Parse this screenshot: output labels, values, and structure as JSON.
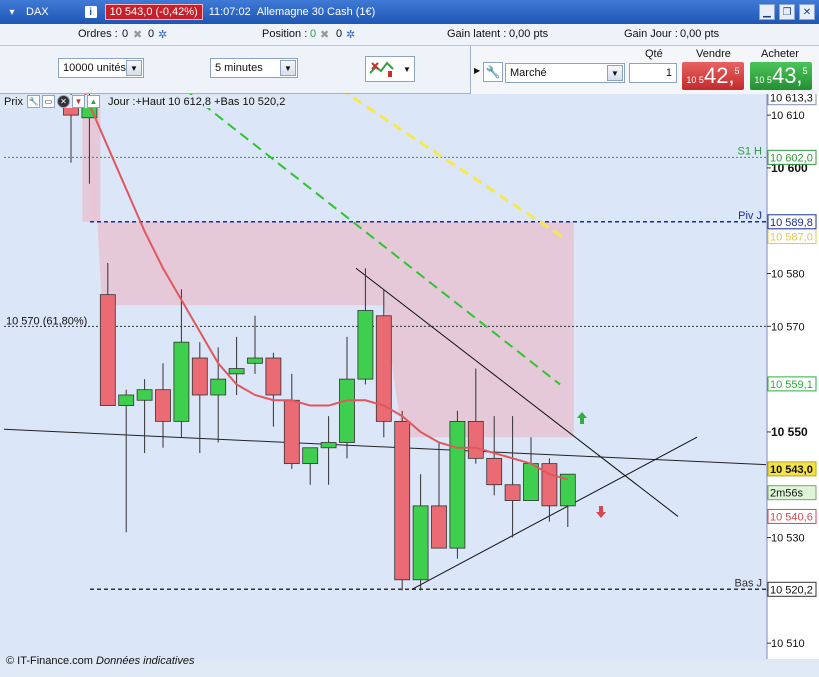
{
  "title_bar": {
    "ticker": "DAX",
    "info_icon": "info-icon",
    "price_change": "10 543,0 (-0,42%)",
    "time": "11:07:02",
    "instrument_name": "Allemagne 30 Cash (1€)"
  },
  "info_row": {
    "orders_label": "Ordres :",
    "orders_value": "0",
    "orders_value2": "0",
    "position_label": "Position :",
    "position_value": "0",
    "position_value2": "0",
    "latent_label": "Gain latent :",
    "latent_value": "0,00 pts",
    "day_label": "Gain Jour :",
    "day_value": "0,00 pts"
  },
  "toolbar": {
    "units_value": "10000 unités",
    "interval_value": "5 minutes",
    "chart_tool_icon": "chart-tools-icon"
  },
  "order_panel": {
    "order_type": "Marché",
    "qty_label": "Qté",
    "qty_value": "1",
    "sell_label": "Vendre",
    "buy_label": "Acheter",
    "sell_prefix": "10 5",
    "sell_big": "42,",
    "sell_sup": "5",
    "buy_prefix": "10 5",
    "buy_big": "43,",
    "buy_sup": "5"
  },
  "chart_header": {
    "prix_label": "Prix",
    "range_text": "Jour :+Haut 10 612,8 +Bas 10 520,2"
  },
  "chart_data": {
    "type": "candlestick",
    "ylim": [
      10507,
      10614
    ],
    "y_ticks": [
      10510,
      10520,
      10530,
      10550,
      10570,
      10580,
      10600,
      10610
    ],
    "y_tick_labels": [
      "10 510",
      "10 520",
      "10 530",
      "10 550",
      "10 570",
      "10 580",
      "10 600",
      "10 610"
    ],
    "bold_ticks": [
      10550,
      10600
    ],
    "candles": [
      {
        "o": 10612.5,
        "h": 10615,
        "l": 10601,
        "c": 10610
      },
      {
        "o": 10609.5,
        "h": 10614,
        "l": 10597,
        "c": 10612
      },
      {
        "o": 10576,
        "h": 10582,
        "l": 10556,
        "c": 10555
      },
      {
        "o": 10555,
        "h": 10558,
        "l": 10531,
        "c": 10557
      },
      {
        "o": 10556,
        "h": 10560,
        "l": 10546,
        "c": 10558
      },
      {
        "o": 10558,
        "h": 10563,
        "l": 10547,
        "c": 10552
      },
      {
        "o": 10552,
        "h": 10577,
        "l": 10549,
        "c": 10567
      },
      {
        "o": 10564,
        "h": 10567,
        "l": 10546,
        "c": 10557
      },
      {
        "o": 10557,
        "h": 10566,
        "l": 10548,
        "c": 10560
      },
      {
        "o": 10561,
        "h": 10568,
        "l": 10557,
        "c": 10562
      },
      {
        "o": 10563,
        "h": 10572,
        "l": 10561,
        "c": 10564
      },
      {
        "o": 10564,
        "h": 10565,
        "l": 10551,
        "c": 10557
      },
      {
        "o": 10556,
        "h": 10561,
        "l": 10543,
        "c": 10544
      },
      {
        "o": 10544,
        "h": 10547,
        "l": 10540,
        "c": 10547
      },
      {
        "o": 10547,
        "h": 10553,
        "l": 10540,
        "c": 10548
      },
      {
        "o": 10548,
        "h": 10568,
        "l": 10545,
        "c": 10560
      },
      {
        "o": 10560,
        "h": 10581,
        "l": 10559,
        "c": 10573
      },
      {
        "o": 10572,
        "h": 10577,
        "l": 10549,
        "c": 10552
      },
      {
        "o": 10552,
        "h": 10554,
        "l": 10520,
        "c": 10522
      },
      {
        "o": 10522,
        "h": 10542,
        "l": 10520,
        "c": 10536
      },
      {
        "o": 10536,
        "h": 10548,
        "l": 10530,
        "c": 10528
      },
      {
        "o": 10528,
        "h": 10554,
        "l": 10526,
        "c": 10552
      },
      {
        "o": 10552,
        "h": 10562,
        "l": 10544,
        "c": 10545
      },
      {
        "o": 10545,
        "h": 10553,
        "l": 10538,
        "c": 10540
      },
      {
        "o": 10540,
        "h": 10553,
        "l": 10530,
        "c": 10537
      },
      {
        "o": 10537,
        "h": 10549,
        "l": 10537,
        "c": 10544
      },
      {
        "o": 10544,
        "h": 10545,
        "l": 10533,
        "c": 10536
      },
      {
        "o": 10536,
        "h": 10542,
        "l": 10532,
        "c": 10542
      }
    ],
    "moving_average": [
      10621,
      10612,
      10604,
      10596,
      10588,
      10581,
      10575,
      10569,
      10563,
      10559,
      10557,
      10556,
      10556,
      10555,
      10555,
      10556,
      10556,
      10555,
      10553,
      10550,
      10548,
      10547,
      10547,
      10546,
      10545,
      10544,
      10542,
      10541
    ],
    "levels": [
      {
        "label": "S1 H",
        "value": 10602,
        "badge": "10 602,0",
        "color": "#2e9a3e",
        "style": "dotted"
      },
      {
        "label": "Piv J",
        "value": 10589.8,
        "badge": "10 589,8",
        "color": "#1a2f9a",
        "style": "dashed"
      },
      {
        "label": "10 570 (61,80%)",
        "value": 10570,
        "badge": "",
        "color": "#333333",
        "style": "dotted"
      },
      {
        "label": "Bas J",
        "value": 10520.2,
        "badge": "10 520,2",
        "color": "#333333",
        "style": "dashed"
      }
    ],
    "price_badges": [
      {
        "text": "10 613,3",
        "value": 10613.3,
        "bg": "#ffffff",
        "fg": "#111111",
        "border": "#7d8fb0"
      },
      {
        "text": "10 587,0",
        "value": 10587,
        "bg": "#ffffff",
        "fg": "#e6c84a",
        "border": "#e6c84a"
      },
      {
        "text": "10 559,1",
        "value": 10559.1,
        "bg": "#ffffff",
        "fg": "#2eae3e",
        "border": "#2eae3e"
      },
      {
        "text": "10 543,0",
        "value": 10543,
        "bg": "#f3e24a",
        "fg": "#111111",
        "border": "#b8a520"
      },
      {
        "text": "2m56s",
        "value": 10538.5,
        "bg": "#dff5d8",
        "fg": "#111111",
        "border": "#7aa86a"
      },
      {
        "text": "10 540,6",
        "value": 10534,
        "bg": "#ffffff",
        "fg": "#d9474f",
        "border": "#d9474f"
      }
    ],
    "colors": {
      "up": "#3fcf4f",
      "down": "#ea6b73",
      "zone": "#e8c3d4",
      "ma": "#e0585e",
      "yellow_line": "#f6e94f",
      "green_line": "#2fc52f",
      "background": "#dbe6f8"
    }
  },
  "footer": {
    "source": "© IT-Finance.com",
    "note": "Données indicatives"
  }
}
